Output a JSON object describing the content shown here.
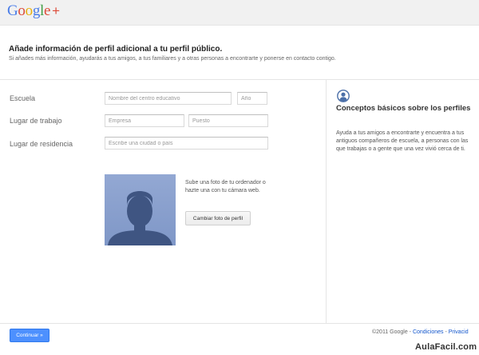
{
  "header": {
    "logo_letters": [
      {
        "char": "G",
        "color": "#4a7de8"
      },
      {
        "char": "o",
        "color": "#dd4b39"
      },
      {
        "char": "o",
        "color": "#e8b00f"
      },
      {
        "char": "g",
        "color": "#4a7de8"
      },
      {
        "char": "l",
        "color": "#3f9d45"
      },
      {
        "char": "e",
        "color": "#dd4b39"
      }
    ],
    "logo_plus": "+"
  },
  "main": {
    "title": "Añade información de perfil adicional a tu perfil público.",
    "subtitle": "Si añades más información, ayudarás a tus amigos, a tus familiares y a otras personas a encontrarte y ponerse en contacto contigo."
  },
  "form": {
    "school_label": "Escuela",
    "school_placeholder": "Nombre del centro educativo",
    "year_placeholder": "Año",
    "work_label": "Lugar de trabajo",
    "company_placeholder": "Empresa",
    "position_placeholder": "Puesto",
    "residence_label": "Lugar de residencia",
    "residence_placeholder": "Escribe una ciudad o país"
  },
  "photo": {
    "description": "Sube una foto de tu ordenador o hazte una con tu cámara web.",
    "button_label": "Cambiar foto de perfil"
  },
  "sidebar": {
    "icon": "user-circle-icon",
    "title": "Conceptos básicos sobre los perfiles",
    "text": "Ayuda a tus amigos a encontrarte y encuentra a tus antiguos compañeros de escuela, a personas con las que trabajas o a gente que una vez vivió cerca de ti."
  },
  "footer": {
    "continue_label": "Continuar »",
    "copyright": "©2011 Google",
    "sep": " - ",
    "conditions_link": "Condiciones",
    "privacy_link": "Privacid"
  },
  "watermark": "AulaFacil.com",
  "colors": {
    "primary_button": "#4d90fe",
    "link": "#1155cc",
    "avatar_bg": "#8aa0cf",
    "silhouette": "#3f5582"
  }
}
